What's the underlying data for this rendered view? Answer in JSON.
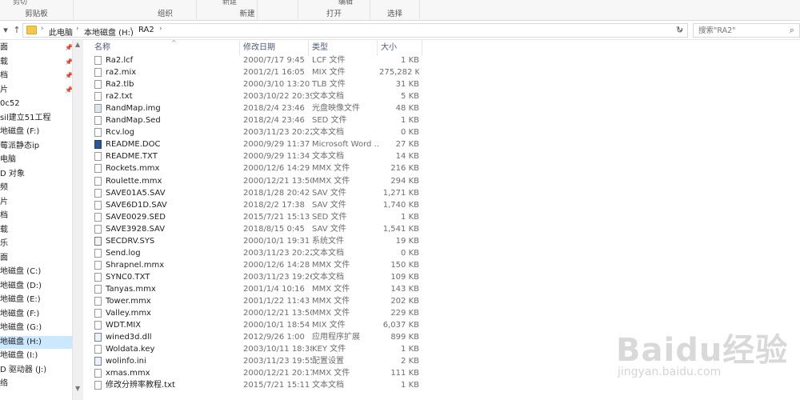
{
  "ribbon": {
    "groups": [
      "剪贴板",
      "组织",
      "新建",
      "打开",
      "选择"
    ],
    "top_fragments": [
      "剪切",
      "新建",
      "编辑"
    ]
  },
  "address": {
    "crumbs": [
      "此电脑",
      "本地磁盘 (H:)",
      "RA2"
    ],
    "search_placeholder": "搜索\"RA2\""
  },
  "nav": {
    "items": [
      "面",
      "载",
      "档",
      "片",
      "0c52",
      "sil建立51工程",
      "地磁盘 (F:)",
      "莓派静态ip",
      "电脑",
      "D 对象",
      "频",
      "片",
      "档",
      "载",
      "乐",
      "面",
      "地磁盘 (C:)",
      "地磁盘 (D:)",
      "地磁盘 (E:)",
      "地磁盘 (F:)",
      "地磁盘 (G:)",
      "地磁盘 (H:)",
      "地磁盘 (I:)",
      "D 驱动器 (J:)",
      "络"
    ]
  },
  "columns": {
    "name": "名称",
    "date": "修改日期",
    "type": "类型",
    "size": "大小"
  },
  "files": [
    {
      "name": "Ra2.lcf",
      "date": "2000/7/17 9:45",
      "type": "LCF 文件",
      "size": "1 KB",
      "icon": "file-icon"
    },
    {
      "name": "ra2.mix",
      "date": "2001/2/1 16:05",
      "type": "MIX 文件",
      "size": "275,282 KB",
      "icon": "file-icon"
    },
    {
      "name": "Ra2.tlb",
      "date": "2000/3/10 13:20",
      "type": "TLB 文件",
      "size": "31 KB",
      "icon": "file-icon"
    },
    {
      "name": "ra2.txt",
      "date": "2003/10/22 20:39",
      "type": "文本文档",
      "size": "5 KB",
      "icon": "text-file-icon"
    },
    {
      "name": "RandMap.img",
      "date": "2018/2/4 23:46",
      "type": "光盘映像文件",
      "size": "48 KB",
      "icon": "disc-image-icon"
    },
    {
      "name": "RandMap.Sed",
      "date": "2018/2/4 23:46",
      "type": "SED 文件",
      "size": "1 KB",
      "icon": "file-icon"
    },
    {
      "name": "Rcv.log",
      "date": "2003/11/23 20:22",
      "type": "文本文档",
      "size": "0 KB",
      "icon": "text-file-icon"
    },
    {
      "name": "README.DOC",
      "date": "2000/9/29 11:37",
      "type": "Microsoft Word ...",
      "size": "27 KB",
      "icon": "word-doc-icon"
    },
    {
      "name": "README.TXT",
      "date": "2000/9/29 11:34",
      "type": "文本文档",
      "size": "14 KB",
      "icon": "text-file-icon"
    },
    {
      "name": "Rockets.mmx",
      "date": "2000/12/6 14:29",
      "type": "MMX 文件",
      "size": "216 KB",
      "icon": "file-icon"
    },
    {
      "name": "Roulette.mmx",
      "date": "2000/12/21 13:50",
      "type": "MMX 文件",
      "size": "294 KB",
      "icon": "file-icon"
    },
    {
      "name": "SAVE01A5.SAV",
      "date": "2018/1/28 20:42",
      "type": "SAV 文件",
      "size": "1,271 KB",
      "icon": "file-icon"
    },
    {
      "name": "SAVE6D1D.SAV",
      "date": "2018/2/2 17:38",
      "type": "SAV 文件",
      "size": "1,740 KB",
      "icon": "file-icon"
    },
    {
      "name": "SAVE0029.SED",
      "date": "2015/7/21 15:13",
      "type": "SED 文件",
      "size": "1 KB",
      "icon": "file-icon"
    },
    {
      "name": "SAVE3928.SAV",
      "date": "2018/8/15 0:45",
      "type": "SAV 文件",
      "size": "1,541 KB",
      "icon": "file-icon"
    },
    {
      "name": "SECDRV.SYS",
      "date": "2000/10/1 19:31",
      "type": "系统文件",
      "size": "19 KB",
      "icon": "system-file-icon"
    },
    {
      "name": "Send.log",
      "date": "2003/11/23 20:22",
      "type": "文本文档",
      "size": "0 KB",
      "icon": "text-file-icon"
    },
    {
      "name": "Shrapnel.mmx",
      "date": "2000/12/6 14:28",
      "type": "MMX 文件",
      "size": "150 KB",
      "icon": "file-icon"
    },
    {
      "name": "SYNC0.TXT",
      "date": "2003/11/23 19:26",
      "type": "文本文档",
      "size": "109 KB",
      "icon": "text-file-icon"
    },
    {
      "name": "Tanyas.mmx",
      "date": "2001/1/4 10:16",
      "type": "MMX 文件",
      "size": "143 KB",
      "icon": "file-icon"
    },
    {
      "name": "Tower.mmx",
      "date": "2001/1/22 11:43",
      "type": "MMX 文件",
      "size": "202 KB",
      "icon": "file-icon"
    },
    {
      "name": "Valley.mmx",
      "date": "2000/12/21 13:50",
      "type": "MMX 文件",
      "size": "229 KB",
      "icon": "file-icon"
    },
    {
      "name": "WDT.MIX",
      "date": "2000/10/1 18:54",
      "type": "MIX 文件",
      "size": "6,037 KB",
      "icon": "file-icon"
    },
    {
      "name": "wined3d.dll",
      "date": "2012/9/26 1:00",
      "type": "应用程序扩展",
      "size": "899 KB",
      "icon": "dll-icon"
    },
    {
      "name": "Woldata.key",
      "date": "2003/10/11 18:38",
      "type": "KEY 文件",
      "size": "1 KB",
      "icon": "file-icon"
    },
    {
      "name": "wolinfo.ini",
      "date": "2003/11/23 19:55",
      "type": "配置设置",
      "size": "2 KB",
      "icon": "config-file-icon"
    },
    {
      "name": "xmas.mmx",
      "date": "2000/12/21 20:17",
      "type": "MMX 文件",
      "size": "111 KB",
      "icon": "file-icon"
    },
    {
      "name": "修改分辨率教程.txt",
      "date": "2015/7/21 15:11",
      "type": "文本文档",
      "size": "1 KB",
      "icon": "text-file-icon"
    }
  ],
  "watermark": {
    "brand": "Baidu经验",
    "url": "jingyan.baidu.com"
  }
}
